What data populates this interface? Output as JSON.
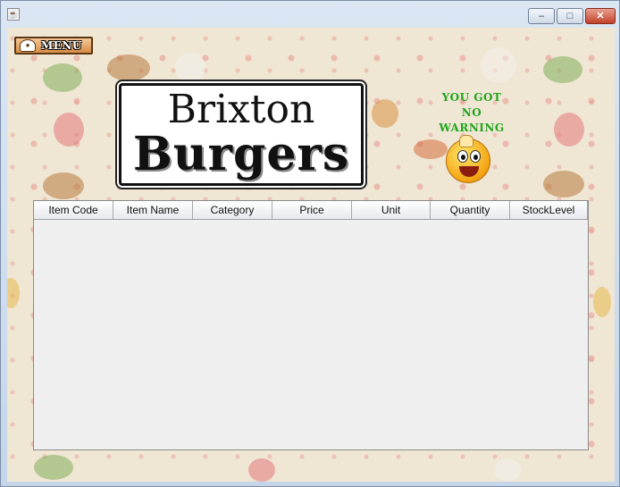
{
  "window": {
    "icon": "java-app-icon",
    "controls": {
      "minimize": "‒",
      "maximize": "□",
      "close": "✕"
    }
  },
  "menu_button": {
    "label": "MENU",
    "icon": "chef-hat-icon"
  },
  "logo": {
    "line1": "Brixton",
    "line2": "Burgers"
  },
  "warning": {
    "lines": [
      "YOU GOT",
      "NO",
      "WARNING"
    ],
    "color": "#21a61b",
    "icon": "smiley-icon"
  },
  "table": {
    "columns": [
      "Item Code",
      "Item Name",
      "Category",
      "Price",
      "Unit",
      "Quantity",
      "StockLevel"
    ],
    "rows": []
  },
  "colors": {
    "background": "#efe6d4",
    "menu_button": "#d98d45",
    "close_button": "#c2412a"
  }
}
